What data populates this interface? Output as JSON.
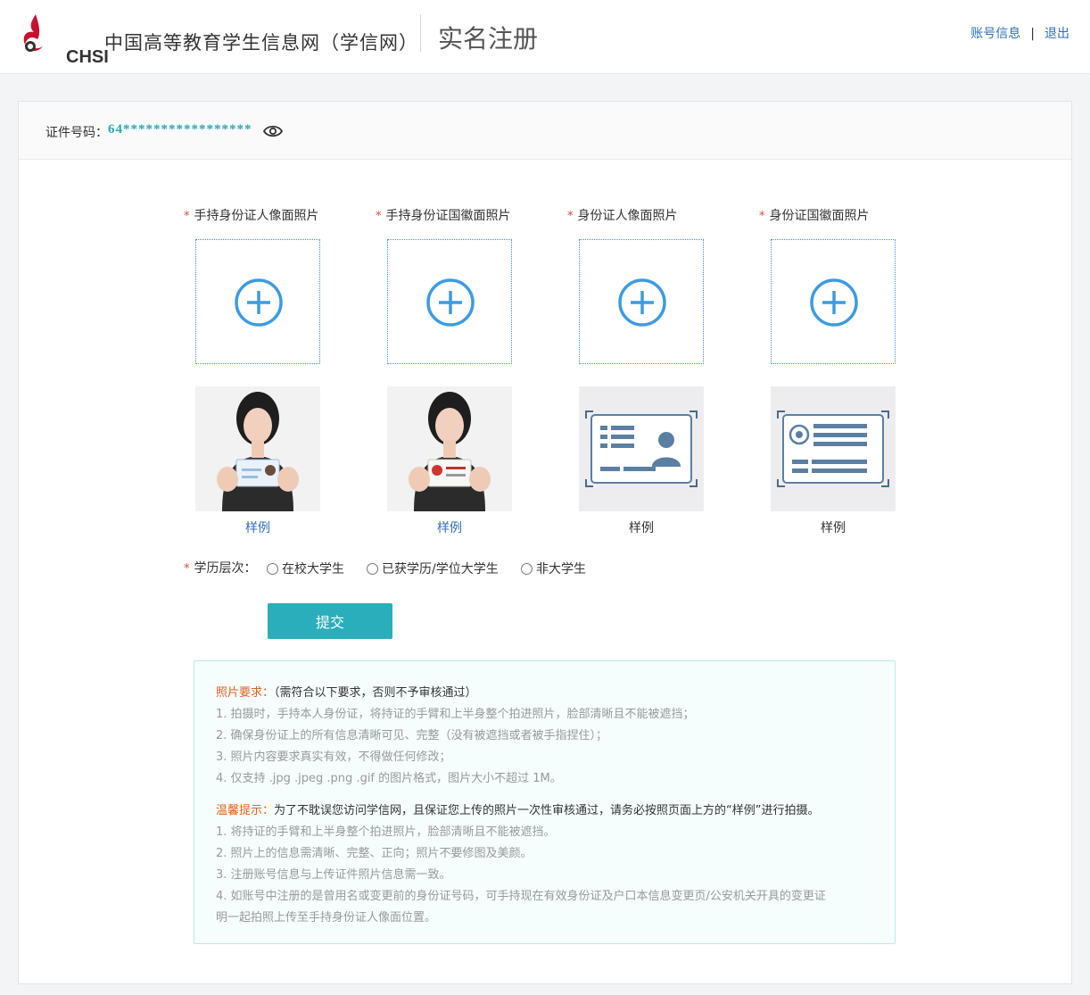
{
  "header": {
    "logo_text": "CHSI",
    "site_name": "中国高等教育学生信息网（学信网）",
    "page_title": "实名注册",
    "account_link": "账号信息",
    "separator": "|",
    "logout_link": "退出"
  },
  "id_bar": {
    "label": "证件号码：",
    "value": "64*****************"
  },
  "uploads": [
    {
      "label": "手持身份证人像面照片",
      "sample_label": "样例",
      "sample_linked": true
    },
    {
      "label": "手持身份证国徽面照片",
      "sample_label": "样例",
      "sample_linked": true
    },
    {
      "label": "身份证人像面照片",
      "sample_label": "样例",
      "sample_linked": false
    },
    {
      "label": "身份证国徽面照片",
      "sample_label": "样例",
      "sample_linked": false
    }
  ],
  "required_mark": "*",
  "education": {
    "label": "学历层次：",
    "options": [
      "在校大学生",
      "已获学历/学位大学生",
      "非大学生"
    ]
  },
  "submit_label": "提交",
  "notice": {
    "photo_req_title": "照片要求：",
    "photo_req_note": "（需符合以下要求，否则不予审核通过）",
    "photo_req_items": [
      "1. 拍摄时，手持本人身份证，将持证的手臂和上半身整个拍进照片，脸部清晰且不能被遮挡；",
      "2. 确保身份证上的所有信息清晰可见、完整（没有被遮挡或者被手指捏住）；",
      "3. 照片内容要求真实有效，不得做任何修改；",
      "4. 仅支持 .jpg .jpeg .png .gif 的图片格式，图片大小不超过 1M。"
    ],
    "tip_title": "温馨提示：",
    "tip_note": "为了不耽误您访问学信网，且保证您上传的照片一次性审核通过，请务必按照页面上方的“样例”进行拍摄。",
    "tip_items": [
      "1. 将持证的手臂和上半身整个拍进照片，脸部清晰且不能被遮挡。",
      "2. 照片上的信息需清晰、完整、正向；照片不要修图及美颜。",
      "3. 注册账号信息与上传证件照片信息需一致。",
      "4. 如账号中注册的是曾用名或变更前的身份证号码，可手持现在有效身份证及户口本信息变更页/公安机关开具的变更证",
      "明一起拍照上传至手持身份证人像面位置。"
    ]
  },
  "colors": {
    "accent": "#2aaebb",
    "link": "#2f6fb6",
    "upload_border": "#3d8fd8",
    "warning": "#e2621b",
    "required": "#e04a2f"
  },
  "icons": [
    "logo-bird-icon",
    "eye-icon",
    "plus-circle-icon",
    "radio-circle-icon"
  ]
}
